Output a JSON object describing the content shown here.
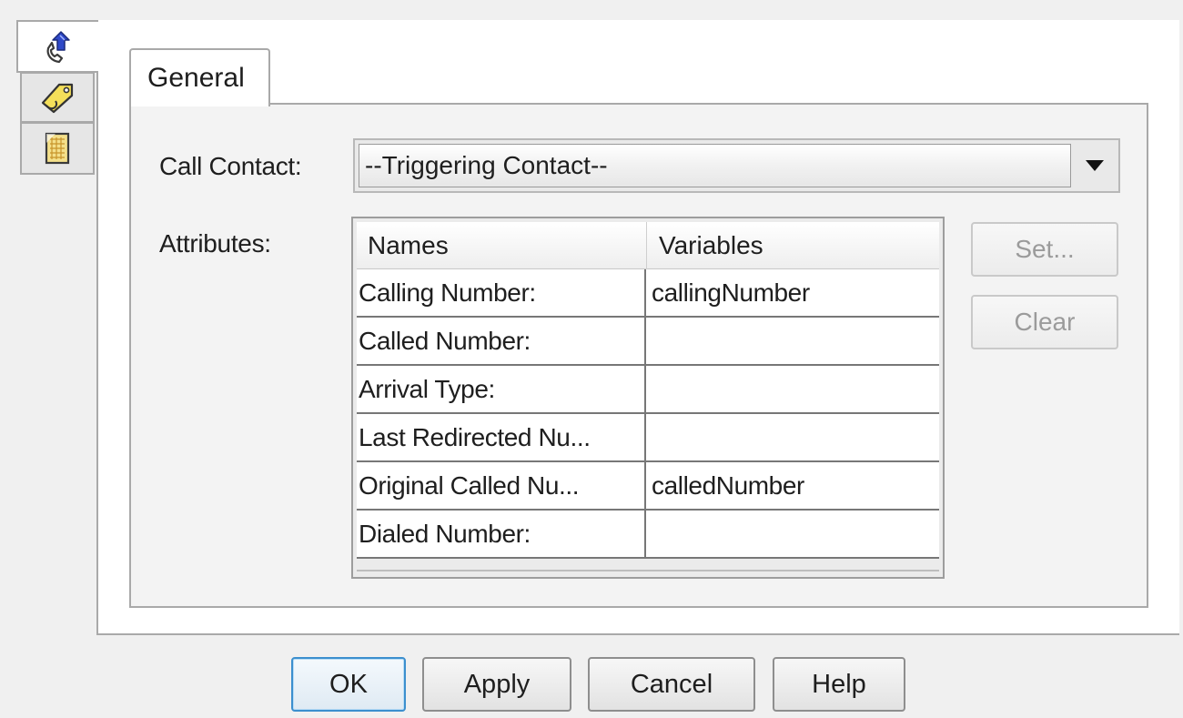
{
  "side_tabs": [
    {
      "icon": "phone-call-icon",
      "active": true
    },
    {
      "icon": "tag-icon",
      "active": false
    },
    {
      "icon": "document-icon",
      "active": false
    }
  ],
  "tab": {
    "label": "General"
  },
  "call_contact": {
    "label": "Call Contact:",
    "selected": "--Triggering Contact--"
  },
  "attributes": {
    "label": "Attributes:",
    "columns": [
      "Names",
      "Variables"
    ],
    "rows": [
      {
        "name": "Calling Number:",
        "variable": "callingNumber"
      },
      {
        "name": "Called Number:",
        "variable": ""
      },
      {
        "name": "Arrival Type:",
        "variable": ""
      },
      {
        "name": "Last Redirected Nu...",
        "variable": ""
      },
      {
        "name": "Original Called Nu...",
        "variable": "calledNumber"
      },
      {
        "name": "Dialed Number:",
        "variable": ""
      }
    ]
  },
  "side_buttons": {
    "set": "Set...",
    "clear": "Clear"
  },
  "dialog_buttons": {
    "ok": "OK",
    "apply": "Apply",
    "cancel": "Cancel",
    "help": "Help"
  },
  "colors": {
    "default_button_border": "#3c8fce",
    "disabled_text": "#9b9b9b",
    "frame_border": "#a9a9a9"
  }
}
